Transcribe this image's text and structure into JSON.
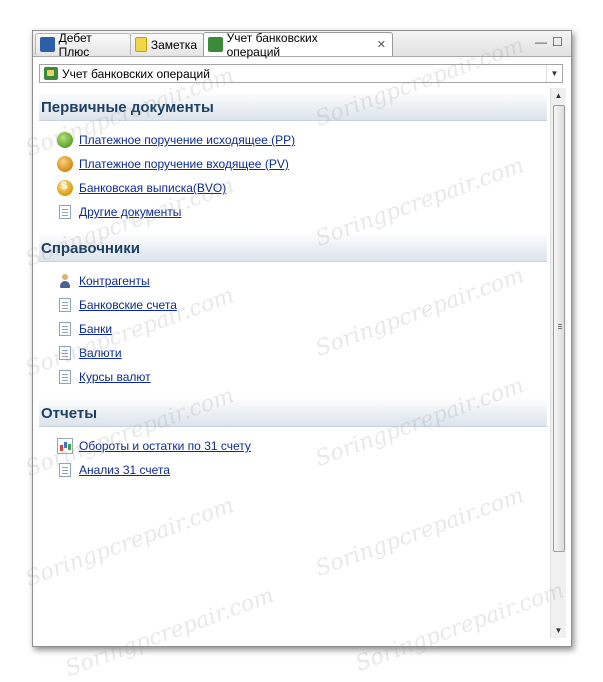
{
  "tabs": [
    {
      "label": "Дебет Плюс",
      "icon": "app-icon"
    },
    {
      "label": "Заметка",
      "icon": "warning-note-icon"
    },
    {
      "label": "Учет банковских операций",
      "icon": "bank-operations-icon",
      "active": true,
      "closable": true
    }
  ],
  "window_controls": {
    "minimize": "—",
    "maximize": "☐"
  },
  "selector": {
    "value": "Учет банковских операций",
    "arrow": "▼"
  },
  "sections": [
    {
      "title": "Первичные документы",
      "items": [
        {
          "label": "Платежное поручение исходящее (PP)",
          "icon": "coin-green-icon"
        },
        {
          "label": "Платежное поручение входящее (PV)",
          "icon": "coin-orange-icon"
        },
        {
          "label": "Банковская выписка(BVO)",
          "icon": "dollar-coin-icon"
        },
        {
          "label": "Другие документы",
          "icon": "document-icon"
        }
      ]
    },
    {
      "title": "Справочники",
      "items": [
        {
          "label": "Контрагенты",
          "icon": "person-icon"
        },
        {
          "label": "Банковские счета",
          "icon": "document-icon"
        },
        {
          "label": "Банки",
          "icon": "document-icon"
        },
        {
          "label": "Валюти",
          "icon": "document-icon"
        },
        {
          "label": "Курсы валют",
          "icon": "document-icon"
        }
      ]
    },
    {
      "title": "Отчеты",
      "items": [
        {
          "label": "Обороты и остатки по 31 счету",
          "icon": "bar-chart-icon"
        },
        {
          "label": "Анализ 31 счета",
          "icon": "document-icon"
        }
      ]
    }
  ],
  "scrollbar": {
    "up": "▲",
    "down": "▼"
  },
  "watermark": "Soringpcrepair.com"
}
